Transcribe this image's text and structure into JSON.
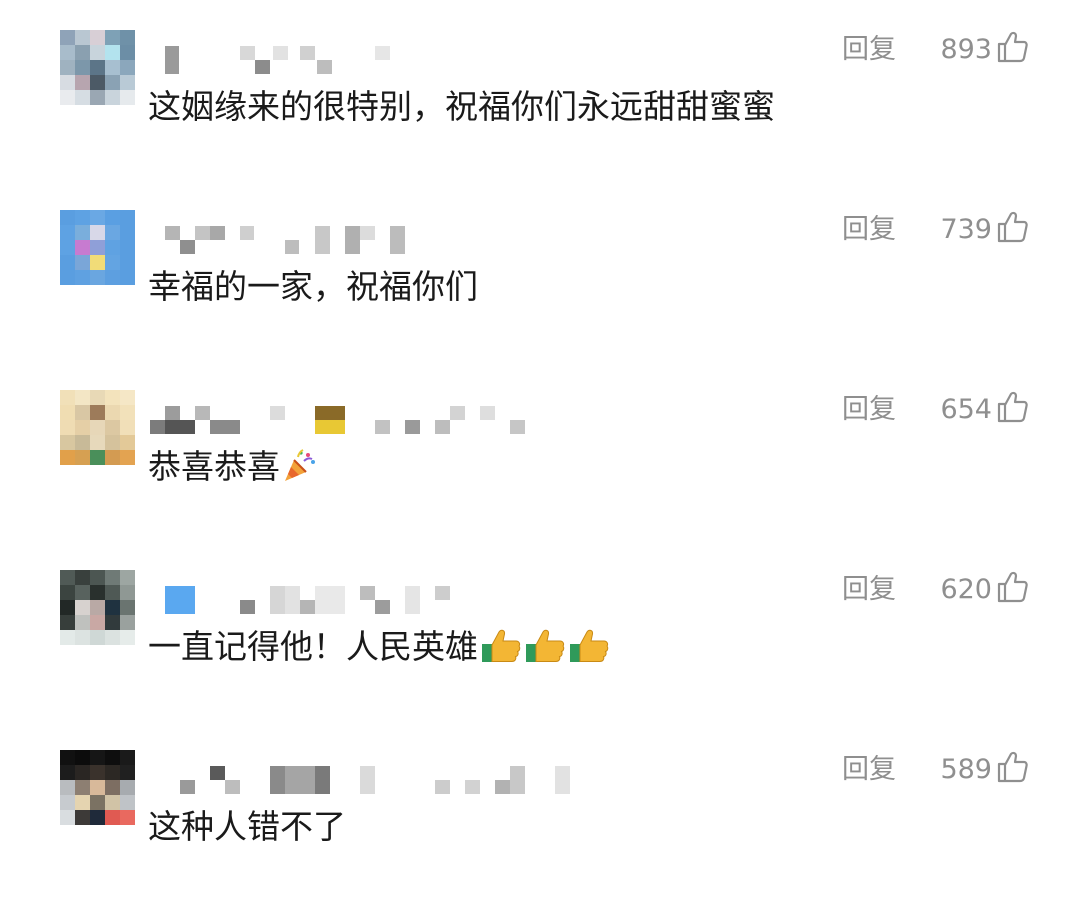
{
  "reply_label": "回复",
  "comments": [
    {
      "text": "这姻缘来的很特别，祝福你们永远甜甜蜜蜜",
      "likes": "893"
    },
    {
      "text": "幸福的一家，祝福你们",
      "likes": "739"
    },
    {
      "text": "恭喜恭喜",
      "likes": "654",
      "emoji": "party-popper-icon"
    },
    {
      "text": "一直记得他！人民英雄",
      "likes": "620",
      "emoji": "thumbs-up-icon x3"
    },
    {
      "text": "这种人错不了",
      "likes": "589"
    }
  ],
  "colors": {
    "meta_gray": "#8f8f8f",
    "text": "#1a1a1a"
  }
}
